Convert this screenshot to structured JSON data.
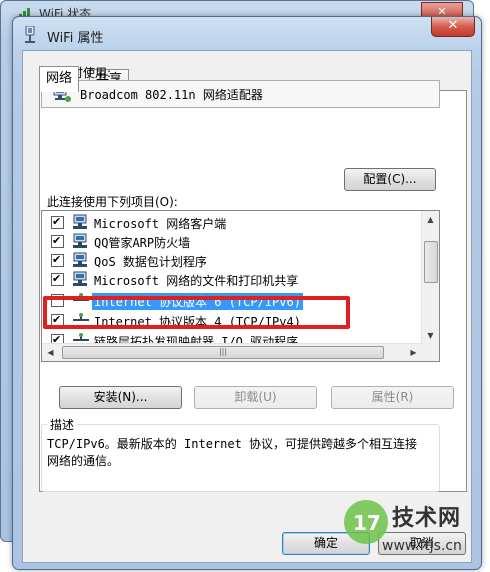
{
  "background_window": {
    "title": "WiFi 状态"
  },
  "dialog": {
    "title": "WiFi 属性",
    "close_label": "✕"
  },
  "tabs": [
    {
      "label": "网络",
      "active": true
    },
    {
      "label": "共享",
      "active": false
    }
  ],
  "connect_using": {
    "label": "连接时使用:",
    "adapter": "Broadcom 802.11n 网络适配器",
    "configure_button": "配置(C)..."
  },
  "items_section": {
    "label": "此连接使用下列项目(O):",
    "items": [
      {
        "label": "Microsoft 网络客户端",
        "checked": true,
        "icon": "network-client-icon"
      },
      {
        "label": "QQ管家ARP防火墙",
        "checked": true,
        "icon": "network-client-icon"
      },
      {
        "label": "QoS 数据包计划程序",
        "checked": true,
        "icon": "network-client-icon"
      },
      {
        "label": "Microsoft 网络的文件和打印机共享",
        "checked": true,
        "icon": "network-client-icon"
      },
      {
        "label": "Internet 协议版本 6 (TCP/IPv6)",
        "checked": false,
        "selected": true,
        "icon": "protocol-icon"
      },
      {
        "label": "Internet 协议版本 4 (TCP/IPv4)",
        "checked": true,
        "icon": "protocol-icon"
      },
      {
        "label": "链路层拓扑发现映射器 I/O 驱动程序",
        "checked": true,
        "icon": "protocol-icon"
      }
    ]
  },
  "buttons": {
    "install": "安装(N)...",
    "uninstall": "卸载(U)",
    "properties": "属性(R)"
  },
  "description": {
    "title": "描述",
    "text": "TCP/IPv6。最新版本的 Internet 协议，可提供跨越多个相互连接网络的通信。"
  },
  "footer": {
    "ok": "确定",
    "cancel": "取消"
  },
  "watermark": {
    "text": "技术网",
    "url": "www.ftjs.cn"
  },
  "colors": {
    "highlight_frame": "#e01f1f",
    "selection": "#3399ff"
  }
}
